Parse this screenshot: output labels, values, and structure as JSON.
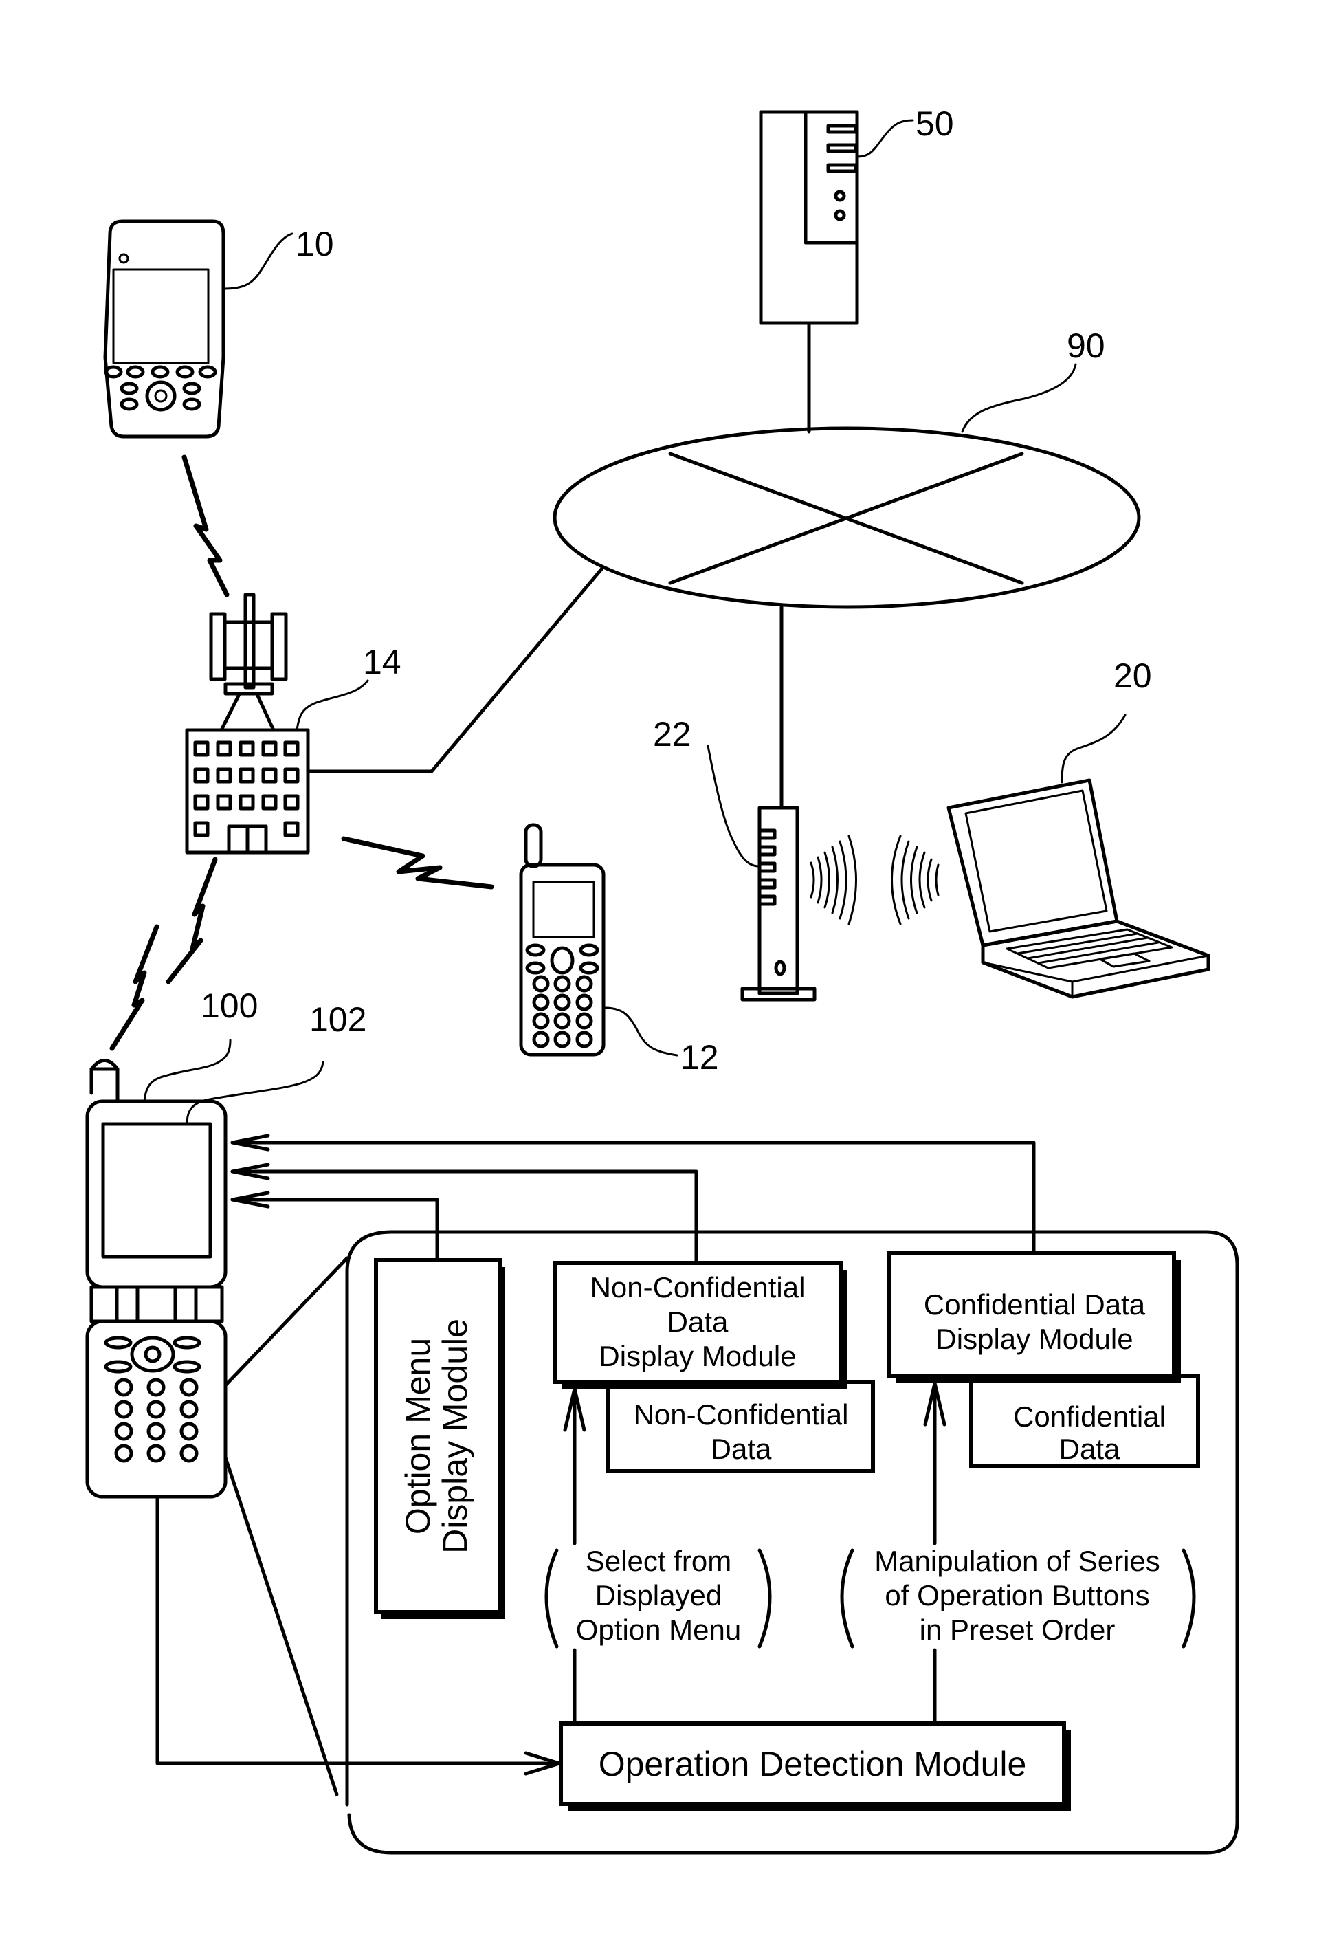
{
  "figure": {
    "reference_numerals": {
      "pda": "10",
      "mobile_phone": "12",
      "base_station": "14",
      "laptop": "20",
      "access_point": "22",
      "server": "50",
      "network": "90",
      "flip_phone": "100",
      "display": "102"
    },
    "modules": {
      "option_menu": [
        "Option Menu",
        "Display Module"
      ],
      "non_confidential_module": [
        "Non-Confidential",
        "Data",
        "Display Module"
      ],
      "non_confidential_data": [
        "Non-Confidential",
        "Data"
      ],
      "confidential_module": [
        "Confidential Data",
        "Display Module"
      ],
      "confidential_data": [
        "Confidential",
        "Data"
      ],
      "operation_detection": "Operation Detection Module"
    },
    "conditions": {
      "select_option": [
        "Select from",
        "Displayed",
        "Option Menu"
      ],
      "manipulation": [
        "Manipulation of Series",
        "of Operation Buttons",
        "in Preset Order"
      ]
    }
  }
}
